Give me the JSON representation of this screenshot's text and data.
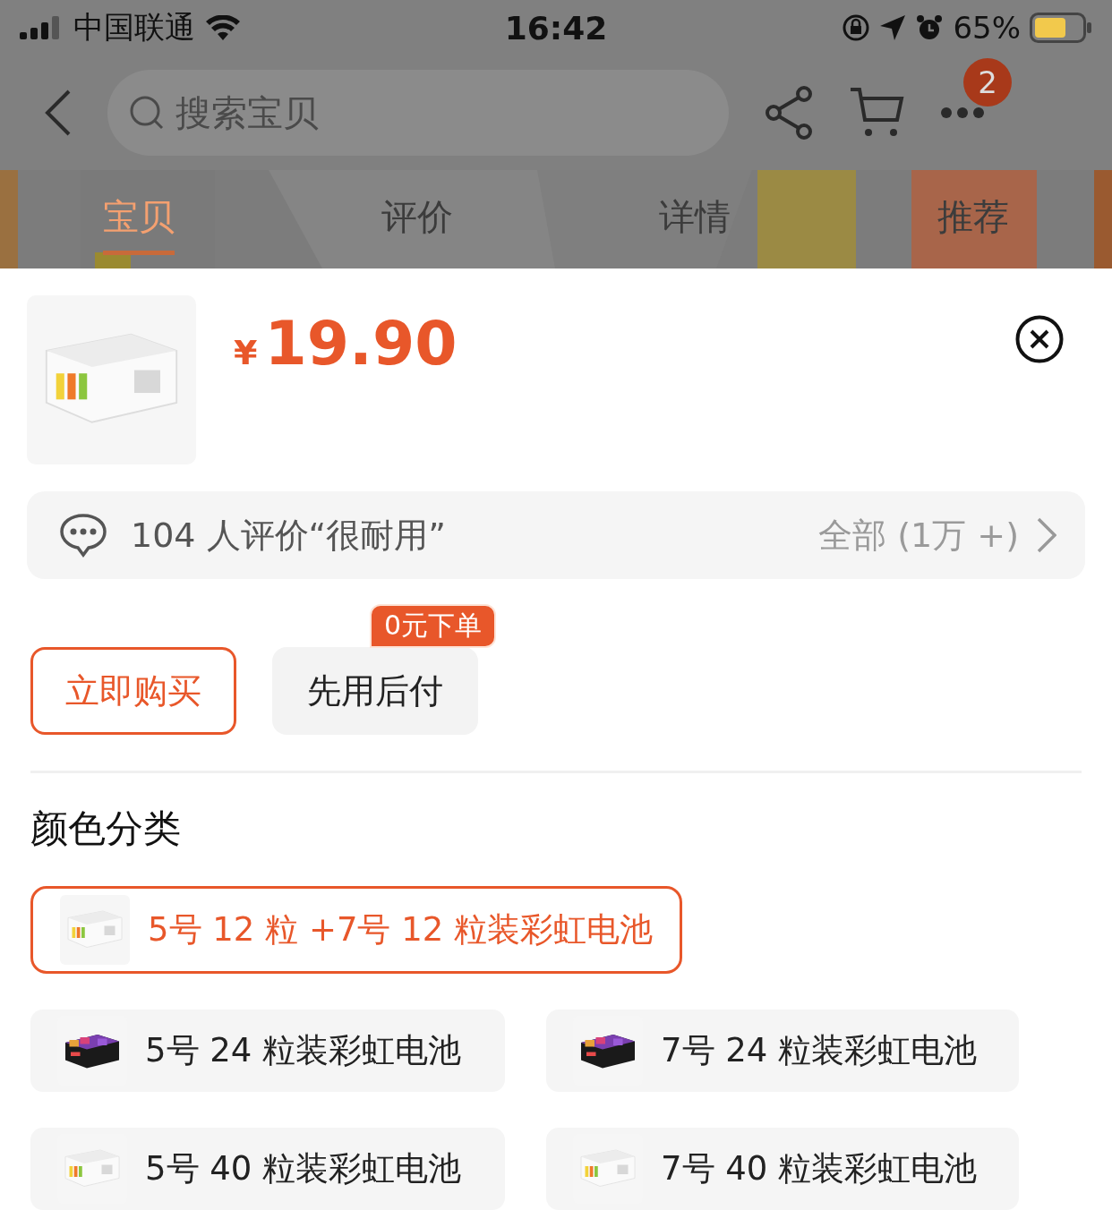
{
  "status_bar": {
    "carrier": "中国联通",
    "time": "16:42",
    "battery": "65%"
  },
  "header": {
    "search": {
      "placeholder": "搜索宝贝"
    },
    "menu_badge": "2"
  },
  "tabs": [
    {
      "label": "宝贝",
      "selected": true
    },
    {
      "label": "评价",
      "selected": false
    },
    {
      "label": "详情",
      "selected": false
    },
    {
      "label": "推荐",
      "selected": false
    }
  ],
  "product": {
    "currency": "¥",
    "price": "19.90"
  },
  "review_bar": {
    "summary": "104 人评价“很耐用”",
    "link": "全部 (1万 +)"
  },
  "actions": [
    {
      "label": "立即购买",
      "kind": "outline"
    },
    {
      "label": "先用后付",
      "kind": "filled",
      "badge": "0元下单"
    }
  ],
  "section_title": "颜色分类",
  "options": [
    {
      "label": "5号 12 粒 +7号 12 粒装彩虹电池",
      "selected": true,
      "kind": "white-box"
    },
    {
      "label": "5号 24 粒装彩虹电池",
      "selected": false,
      "kind": "dark-box"
    },
    {
      "label": "7号 24 粒装彩虹电池",
      "selected": false,
      "kind": "dark-box"
    },
    {
      "label": "5号 40 粒装彩虹电池",
      "selected": false,
      "kind": "white-box"
    },
    {
      "label": "7号 40 粒装彩虹电池",
      "selected": false,
      "kind": "white-box"
    }
  ]
}
